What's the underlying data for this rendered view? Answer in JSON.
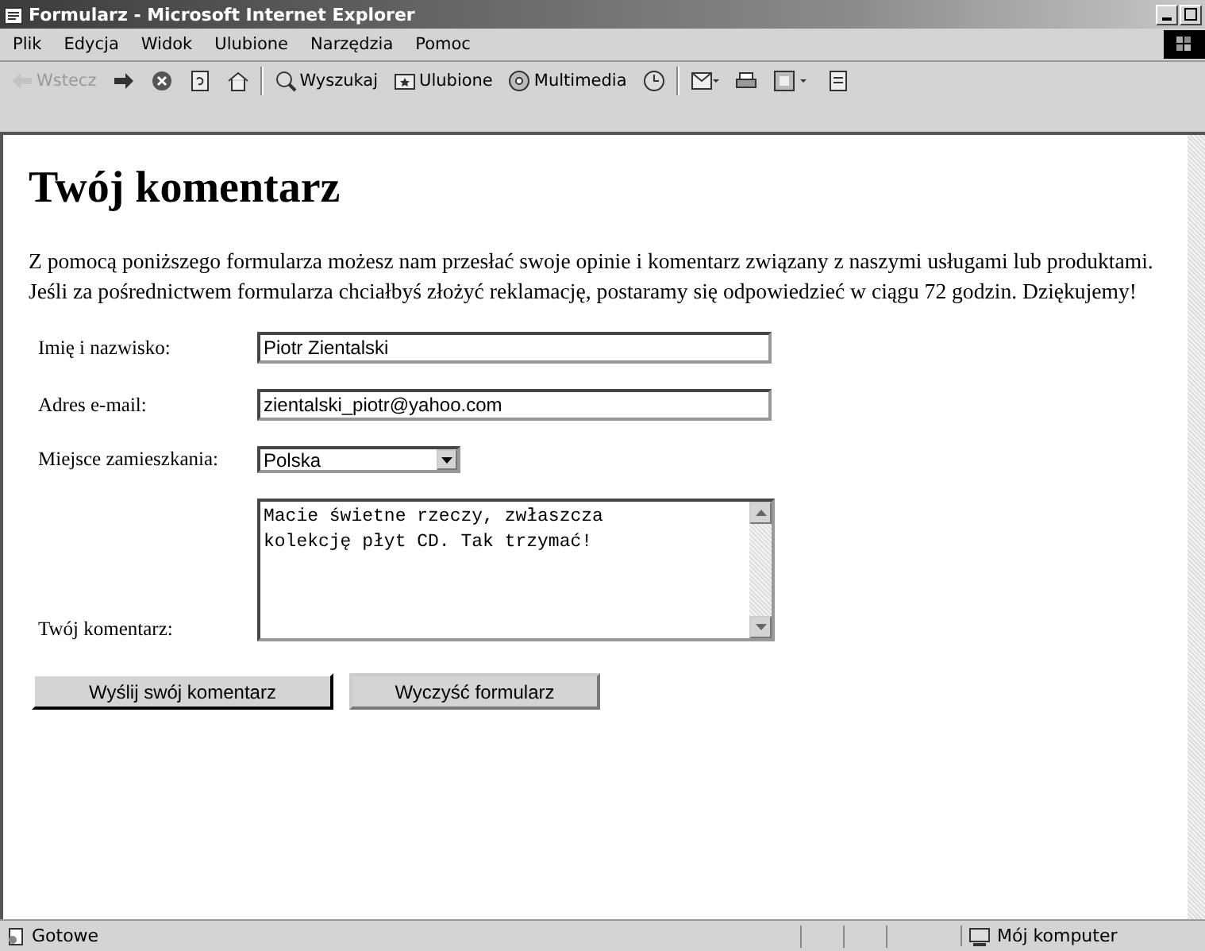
{
  "window": {
    "title": "Formularz - Microsoft Internet Explorer"
  },
  "menu": [
    "Plik",
    "Edycja",
    "Widok",
    "Ulubione",
    "Narzędzia",
    "Pomoc"
  ],
  "toolbar": [
    {
      "kind": "back",
      "label": "Wstecz",
      "disabled": true
    },
    {
      "kind": "forward",
      "disabled": false
    },
    {
      "kind": "stop",
      "disabled": false
    },
    {
      "kind": "refresh",
      "disabled": false
    },
    {
      "kind": "home",
      "disabled": false
    },
    {
      "kind": "search",
      "label": "Wyszukaj",
      "disabled": false
    },
    {
      "kind": "favorites",
      "label": "Ulubione",
      "disabled": false
    },
    {
      "kind": "media",
      "label": "Multimedia",
      "disabled": false
    },
    {
      "kind": "history",
      "disabled": false
    },
    {
      "kind": "mail",
      "disabled": false
    },
    {
      "kind": "print",
      "disabled": false
    },
    {
      "kind": "edit",
      "disabled": false
    },
    {
      "kind": "discuss",
      "disabled": false
    }
  ],
  "page": {
    "heading": "Twój komentarz",
    "intro": [
      "Z pomocą poniższego formularza możesz nam przesłać swoje opinie i komentarz związany z naszymi usługami lub produktami.",
      "Jeśli za pośrednictwem formularza chciałbyś złożyć reklamację, postaramy się odpowiedzieć w ciągu 72 godzin. Dziękujemy!"
    ],
    "fields": [
      {
        "kind": "text",
        "label": "Imię i nazwisko:",
        "value": "Piotr Zientalski"
      },
      {
        "kind": "text",
        "label": "Adres e-mail:",
        "value": "zientalski_piotr@yahoo.com"
      },
      {
        "kind": "select",
        "label": "Miejsce zamieszkania:",
        "value": "Polska"
      },
      {
        "kind": "textarea",
        "label": "Twój komentarz:",
        "value": "Macie świetne rzeczy, zwłaszcza\nkolekcję płyt CD. Tak trzymać!"
      }
    ],
    "buttons": [
      "Wyślij swój komentarz",
      "Wyczyść formularz"
    ]
  },
  "status_bar": {
    "status": "Gotowe",
    "zone": "Mój komputer"
  }
}
